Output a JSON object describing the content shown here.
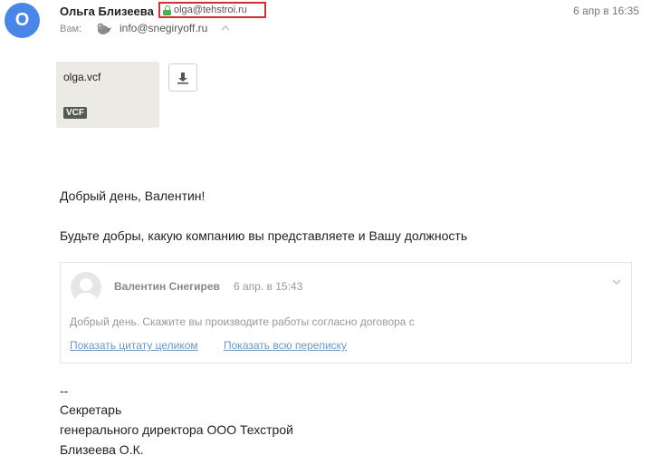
{
  "header": {
    "avatar_letter": "O",
    "sender_name": "Ольга Близеева",
    "sender_email": "olga@tehstroi.ru",
    "date": "6 апр в 16:35",
    "to_label": "Вам:",
    "to_address": "info@snegiryoff.ru"
  },
  "attachment": {
    "filename": "olga.vcf",
    "badge": "VCF",
    "download_icon": "download-icon"
  },
  "body": {
    "greeting": "Добрый день, Валентин!",
    "question": "Будьте добры, какую компанию вы представляете и Вашу должность"
  },
  "quote": {
    "author": "Валентин Снегирев",
    "date": "6 апр. в 15:43",
    "text": "Добрый день. Скажите вы производите работы согласно договора с",
    "link_full_quote": "Показать цитату целиком",
    "link_thread": "Показать всю переписку"
  },
  "signature": {
    "dashes": "--",
    "line1": "Секретарь",
    "line2": "генерального директора ООО Техстрой",
    "line3": "Близеева О.К."
  },
  "colors": {
    "avatar": "#4a86e8",
    "highlight_border": "#d32f2f",
    "lock": "#4caf50",
    "link": "#6d97c0"
  }
}
